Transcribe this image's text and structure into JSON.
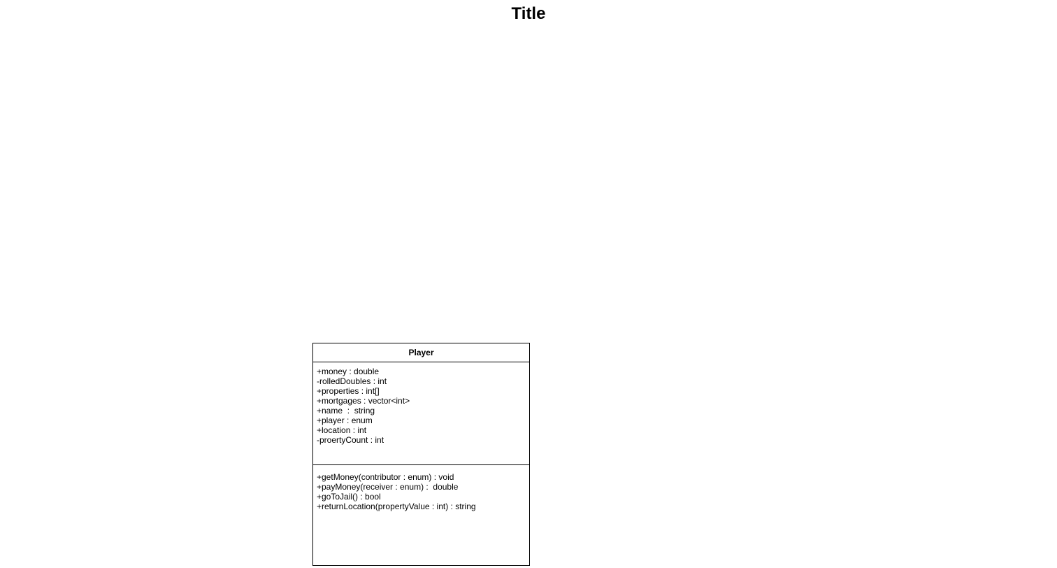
{
  "page": {
    "title": "Title"
  },
  "player_class": {
    "name": "Player",
    "attributes": [
      "+money : double",
      "-rolledDoubles : int",
      "+properties : int[]",
      "+mortgages : vector<int>",
      "+name  :  string",
      "+player : enum",
      "+location : int",
      "-proertyCount : int"
    ],
    "methods": [
      "+getMoney(contributor : enum) : void",
      "+payMoney(receiver : enum) :  double",
      "+goToJail() : bool",
      "+returnLocation(propertyValue : int) : string"
    ]
  },
  "colors": {
    "stroke": "#000000",
    "fill": "#ffffff"
  }
}
